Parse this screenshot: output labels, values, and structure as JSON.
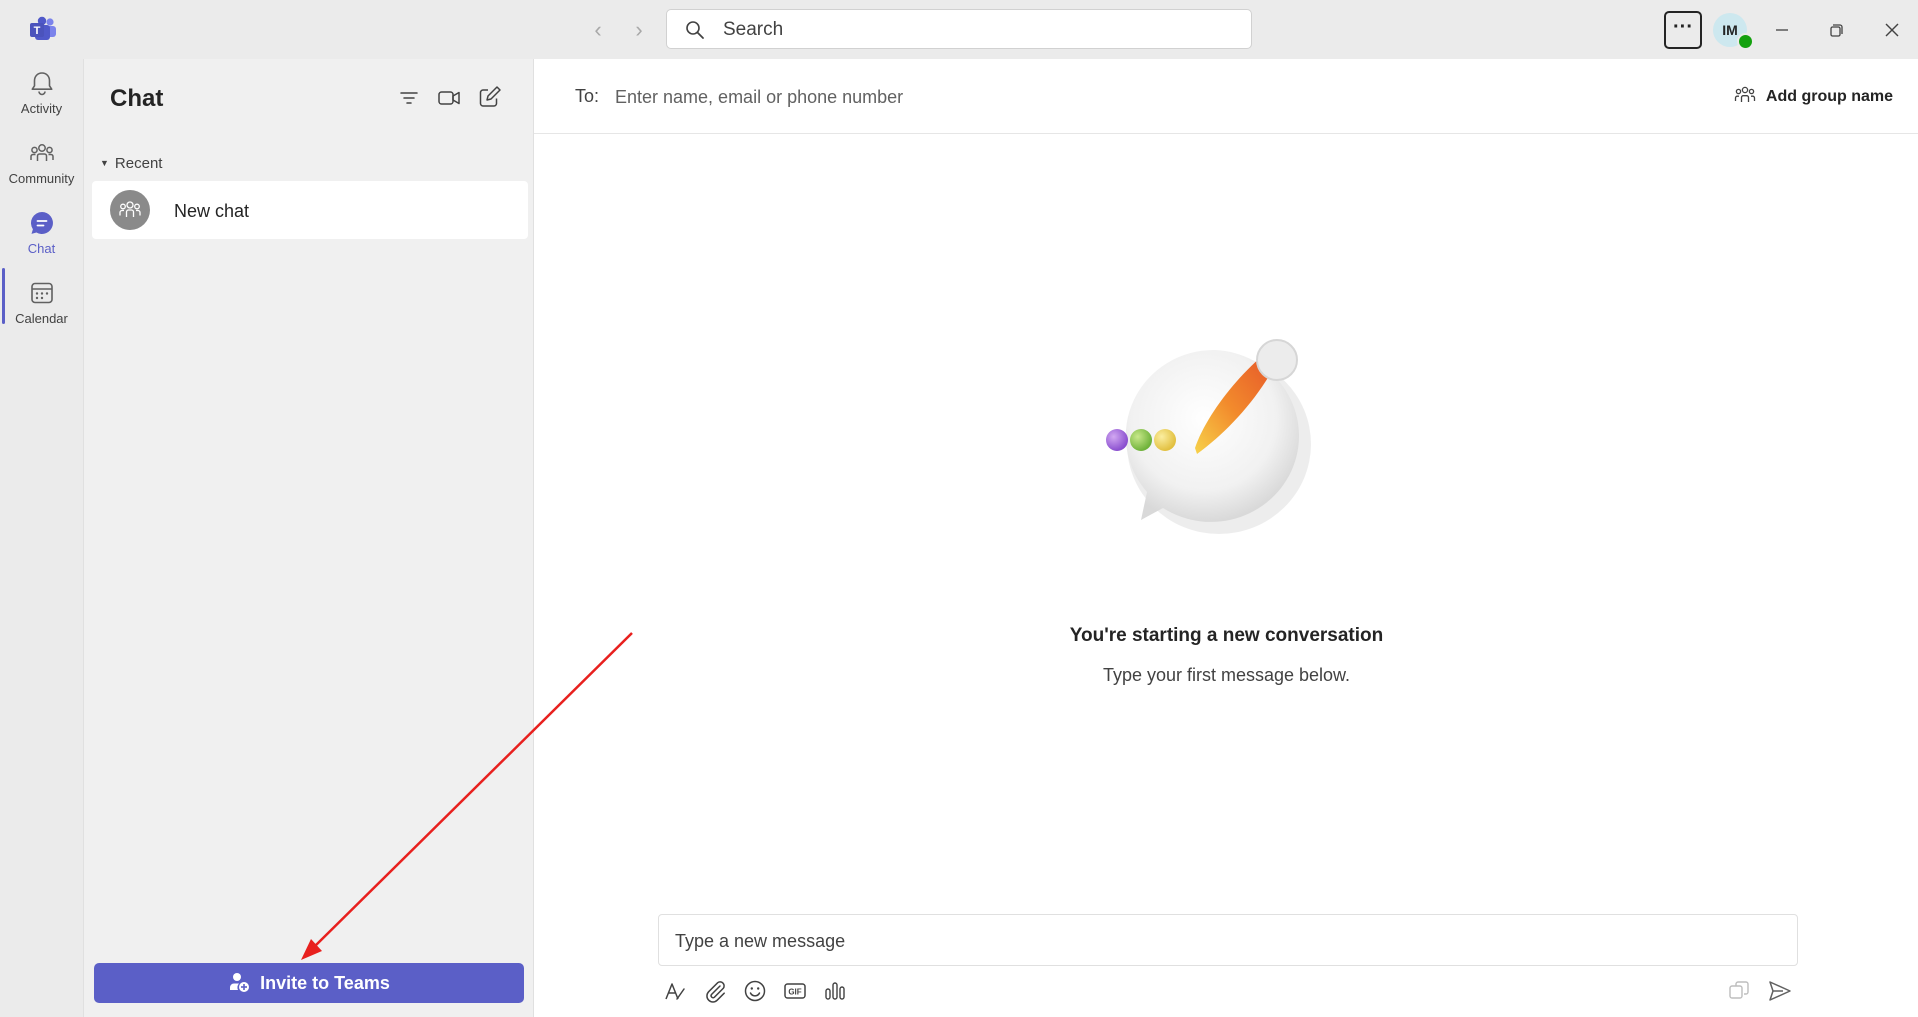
{
  "titlebar": {
    "search_placeholder": "Search",
    "more_label": "···",
    "avatar_initials": "IM"
  },
  "rail": {
    "items": [
      {
        "label": "Activity",
        "icon": "bell-icon"
      },
      {
        "label": "Community",
        "icon": "community-icon"
      },
      {
        "label": "Chat",
        "icon": "chat-icon",
        "active": true
      },
      {
        "label": "Calendar",
        "icon": "calendar-icon"
      }
    ]
  },
  "chat_pane": {
    "title": "Chat",
    "section": "Recent",
    "items": [
      {
        "name": "New chat"
      }
    ],
    "invite_label": "Invite to Teams"
  },
  "main": {
    "to_label": "To:",
    "to_placeholder": "Enter name, email or phone number",
    "add_group_label": "Add group name",
    "empty_title": "You're starting a new conversation",
    "empty_subtitle": "Type your first message below.",
    "compose_placeholder": "Type a new message"
  },
  "colors": {
    "accent": "#5b5fc7",
    "presence": "#13a10e",
    "annotation_arrow": "#e8201e"
  }
}
